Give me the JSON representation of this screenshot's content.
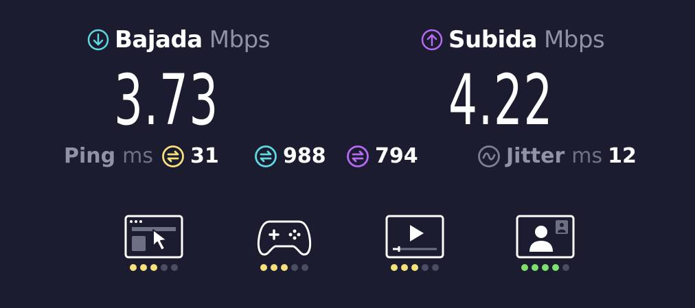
{
  "download": {
    "label": "Bajada",
    "unit": "Mbps",
    "value": "3.73",
    "color": "#5fd9e0",
    "icon": "arrow-down-circle-icon"
  },
  "upload": {
    "label": "Subida",
    "unit": "Mbps",
    "value": "4.22",
    "color": "#b46bf2",
    "icon": "arrow-up-circle-icon"
  },
  "ping": {
    "label": "Ping",
    "unit": "ms",
    "value": "31",
    "color": "#f5e07a"
  },
  "download_latency": {
    "value": "988",
    "color": "#5fd9e0"
  },
  "upload_latency": {
    "value": "794",
    "color": "#b46bf2"
  },
  "jitter": {
    "label": "Jitter",
    "unit": "ms",
    "value": "12",
    "color": "#7d7f93"
  },
  "activities": [
    {
      "icon": "web-browsing-icon",
      "rating": 3,
      "max": 5,
      "color": "#f5e07a"
    },
    {
      "icon": "gamepad-icon",
      "rating": 3,
      "max": 5,
      "color": "#f5e07a"
    },
    {
      "icon": "video-streaming-icon",
      "rating": 3,
      "max": 5,
      "color": "#f5e07a"
    },
    {
      "icon": "video-call-icon",
      "rating": 4,
      "max": 5,
      "color": "#7ee06c"
    }
  ]
}
